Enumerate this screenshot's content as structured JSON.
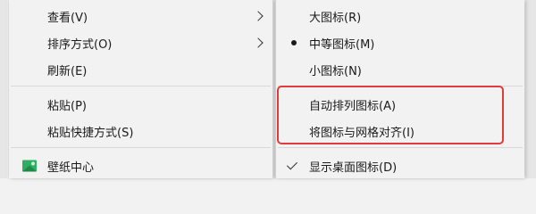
{
  "context_menu": {
    "items": [
      {
        "label": "查看(V)"
      },
      {
        "label": "排序方式(O)"
      },
      {
        "label": "刷新(E)"
      },
      {
        "label": "粘贴(P)"
      },
      {
        "label": "粘贴快捷方式(S)"
      },
      {
        "label": "壁纸中心"
      }
    ]
  },
  "view_submenu": {
    "items": [
      {
        "label": "大图标(R)"
      },
      {
        "label": "中等图标(M)",
        "selected": true
      },
      {
        "label": "小图标(N)"
      },
      {
        "label": "自动排列图标(A)"
      },
      {
        "label": "将图标与网格对齐(I)"
      },
      {
        "label": "显示桌面图标(D)",
        "checked": true
      }
    ]
  },
  "colors": {
    "menu_background": "#f2f2f2",
    "highlight_outline": "#e23b3b",
    "wallpaper_icon": "#2fae63"
  }
}
